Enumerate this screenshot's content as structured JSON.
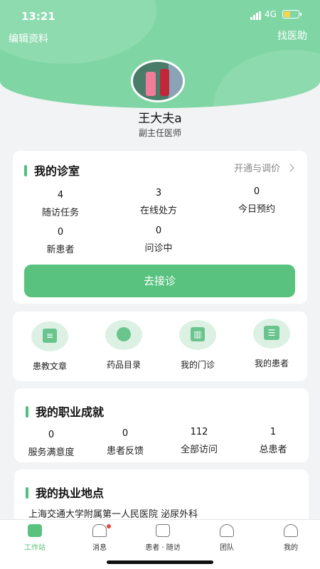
{
  "status": {
    "time": "13:21",
    "network": "4G"
  },
  "header": {
    "edit_label": "编辑资料",
    "helper_label": "找医助"
  },
  "profile": {
    "name": "王大夫a",
    "title": "副主任医师"
  },
  "clinic": {
    "title": "我的诊室",
    "link_label": "开通与调价",
    "stats": [
      {
        "value": "4",
        "label": "随访任务"
      },
      {
        "value": "3",
        "label": "在线处方"
      },
      {
        "value": "0",
        "label": "今日预约"
      },
      {
        "value": "0",
        "label": "新患者"
      },
      {
        "value": "0",
        "label": "问诊中"
      }
    ],
    "button_label": "去接诊"
  },
  "tools": [
    {
      "label": "患教文章",
      "icon": "article-icon"
    },
    {
      "label": "药品目录",
      "icon": "pill-icon"
    },
    {
      "label": "我的门诊",
      "icon": "clinic-icon"
    },
    {
      "label": "我的患者",
      "icon": "patient-card-icon"
    }
  ],
  "achievement": {
    "title": "我的职业成就",
    "stats": [
      {
        "value": "0",
        "label": "服务满意度"
      },
      {
        "value": "0",
        "label": "患者反馈"
      },
      {
        "value": "112",
        "label": "全部访问"
      },
      {
        "value": "1",
        "label": "总患者"
      }
    ]
  },
  "location": {
    "title": "我的执业地点",
    "address": "上海交通大学附属第一人民医院 泌尿外科"
  },
  "tabs": [
    {
      "label": "工作站",
      "icon": "home-icon"
    },
    {
      "label": "消息",
      "icon": "bell-icon"
    },
    {
      "label": "患者 · 随访",
      "icon": "medical-box-icon"
    },
    {
      "label": "团队",
      "icon": "team-icon"
    },
    {
      "label": "我的",
      "icon": "user-icon"
    }
  ],
  "colors": {
    "accent": "#58c27e",
    "header": "#7fd6a4",
    "badge": "#e24b3b"
  }
}
